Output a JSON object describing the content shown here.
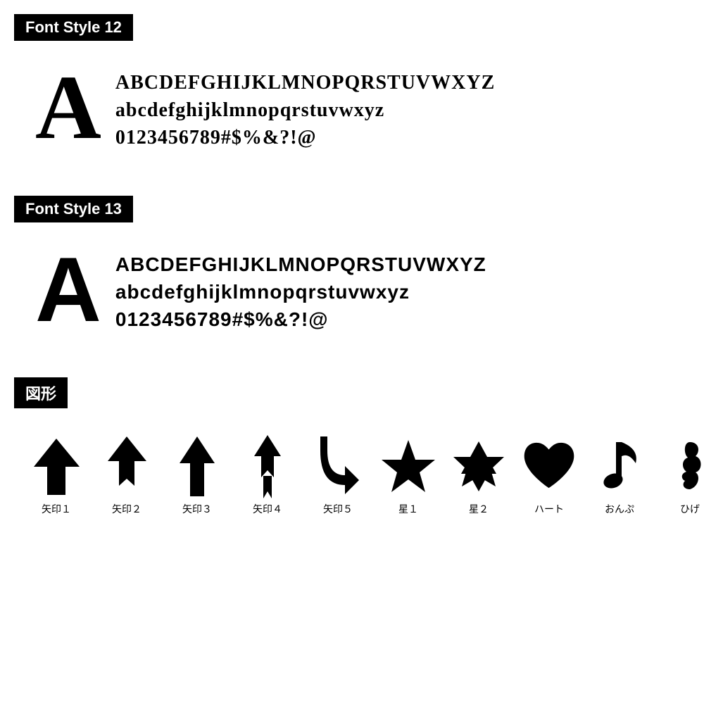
{
  "sections": [
    {
      "id": "font-style-12",
      "label": "Font Style 12",
      "big_letter": "A",
      "lines": [
        "ABCDEFGHIJKLMNOPQRSTUVWXYZ",
        "abcdefghijklmnopqrstuvwxyz",
        "0123456789#$%&?!@"
      ],
      "font_class": "font-style-12"
    },
    {
      "id": "font-style-13",
      "label": "Font Style 13",
      "big_letter": "A",
      "lines": [
        "ABCDEFGHIJKLMNOPQRSTUVWXYZ",
        "abcdefghijklmnopqrstuvwxyz",
        "0123456789#$%&?!@"
      ],
      "font_class": "font-style-13"
    }
  ],
  "shapes_section": {
    "label": "図形",
    "items": [
      {
        "id": "arrow1",
        "label": "矢印１"
      },
      {
        "id": "arrow2",
        "label": "矢印２"
      },
      {
        "id": "arrow3",
        "label": "矢印３"
      },
      {
        "id": "arrow4",
        "label": "矢印４"
      },
      {
        "id": "arrow5",
        "label": "矢印５"
      },
      {
        "id": "star1",
        "label": "星１"
      },
      {
        "id": "star2",
        "label": "星２"
      },
      {
        "id": "heart",
        "label": "ハート"
      },
      {
        "id": "music",
        "label": "おんぷ"
      },
      {
        "id": "mustache",
        "label": "ひげ"
      }
    ]
  }
}
